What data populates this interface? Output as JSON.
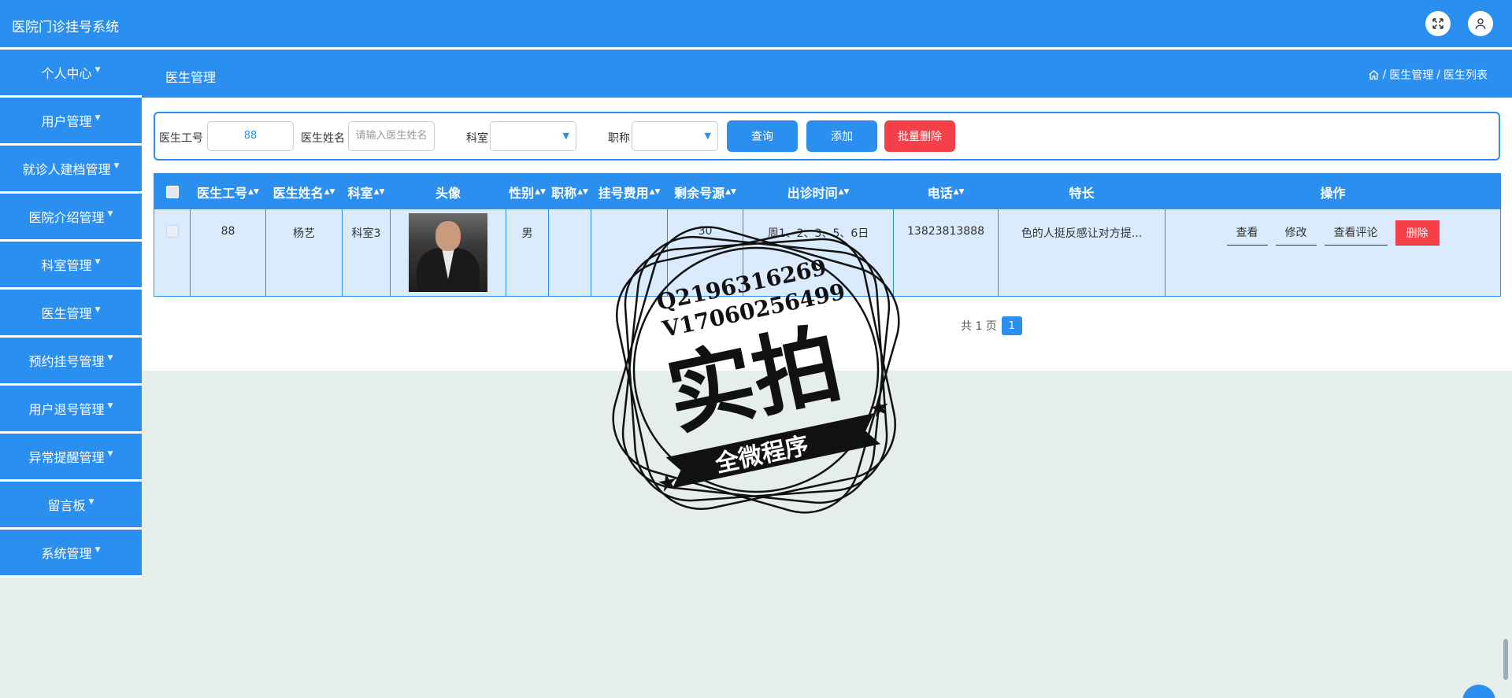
{
  "app": {
    "title": "医院门诊挂号系统"
  },
  "sidebar": {
    "items": [
      {
        "label": "个人中心"
      },
      {
        "label": "用户管理"
      },
      {
        "label": "就诊人建档管理"
      },
      {
        "label": "医院介绍管理"
      },
      {
        "label": "科室管理"
      },
      {
        "label": "医生管理"
      },
      {
        "label": "预约挂号管理"
      },
      {
        "label": "用户退号管理"
      },
      {
        "label": "异常提醒管理"
      },
      {
        "label": "留言板"
      },
      {
        "label": "系统管理"
      }
    ]
  },
  "page": {
    "title": "医生管理",
    "breadcrumb": [
      "医生管理",
      "医生列表"
    ],
    "separator": "/"
  },
  "search": {
    "doctor_id_label": "医生工号",
    "doctor_id_value": "88",
    "doctor_name_label": "医生姓名",
    "doctor_name_placeholder": "请输入医生姓名",
    "dept_label": "科室",
    "title_label": "职称",
    "query_button": "查询",
    "add_button": "添加",
    "batch_delete_button": "批量删除"
  },
  "table": {
    "columns": [
      "医生工号",
      "医生姓名",
      "科室",
      "头像",
      "性别",
      "职称",
      "挂号费用",
      "剩余号源",
      "出诊时间",
      "电话",
      "特长",
      "操作"
    ],
    "rows": [
      {
        "doctor_id": "88",
        "name": "杨艺",
        "dept": "科室3",
        "gender": "男",
        "title": "",
        "fee": "",
        "remaining": "30",
        "schedule": "周1、2、3、5、6日",
        "phone": "13823813888",
        "specialty": "色的人挺反感让对方提..."
      }
    ],
    "actions": [
      "查看",
      "修改",
      "查看评论",
      "删除"
    ]
  },
  "pagination": {
    "text": "共 1 页",
    "current": "1"
  },
  "watermark": {
    "line1": "Q2196316269",
    "line2": "V17060256499",
    "big": "实拍",
    "ribbon": "全微程序"
  },
  "colors": {
    "primary": "#2b8ff0",
    "danger": "#f5404a",
    "row_bg": "#d9ebfc",
    "page_bg": "#e6eeea"
  }
}
